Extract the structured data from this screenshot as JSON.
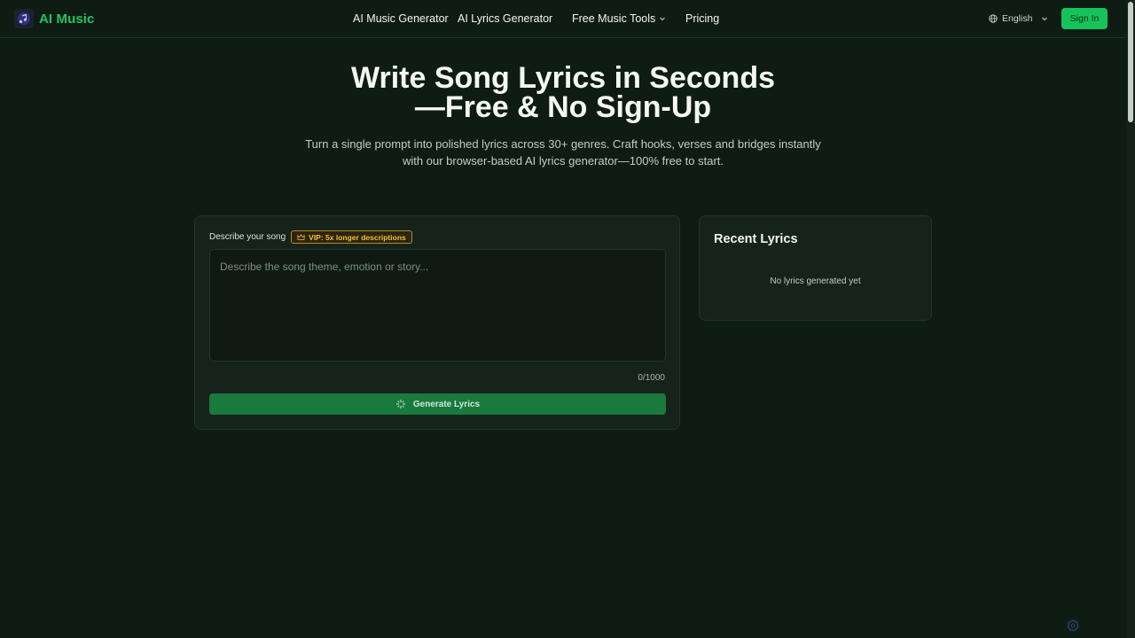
{
  "header": {
    "brand": "AI Music",
    "nav": [
      {
        "label": "AI Music Generator"
      },
      {
        "label": "AI Lyrics Generator"
      },
      {
        "label": "Free Music Tools"
      },
      {
        "label": "Pricing"
      }
    ],
    "language": "English",
    "signin_label": "Sign In"
  },
  "hero": {
    "title_line1": "Write Song Lyrics in Seconds",
    "title_line2": "—Free & No Sign-Up",
    "subtitle_line1": "Turn a single prompt into polished lyrics across 30+ genres. Craft hooks, verses and bridges instantly",
    "subtitle_line2": "with our browser-based AI lyrics generator—100% free to start."
  },
  "form": {
    "label": "Describe your song",
    "vip_badge": "VIP: 5x longer descriptions",
    "placeholder": "Describe the song theme, emotion or story...",
    "value": "",
    "counter": "0/1000",
    "generate_label": "Generate Lyrics"
  },
  "recent": {
    "title": "Recent Lyrics",
    "empty_text": "No lyrics generated yet"
  },
  "colors": {
    "background": "#0f1c14",
    "accent": "#22c55e",
    "button": "#16c35a",
    "generate_button": "#1a7a3e",
    "vip": "#f0bf3a"
  },
  "icons": {
    "brand": "music-note-logo-icon",
    "language": "globe-icon",
    "dropdown": "chevron-down-icon",
    "vip": "crown-icon",
    "generate": "sparkle-icon"
  }
}
